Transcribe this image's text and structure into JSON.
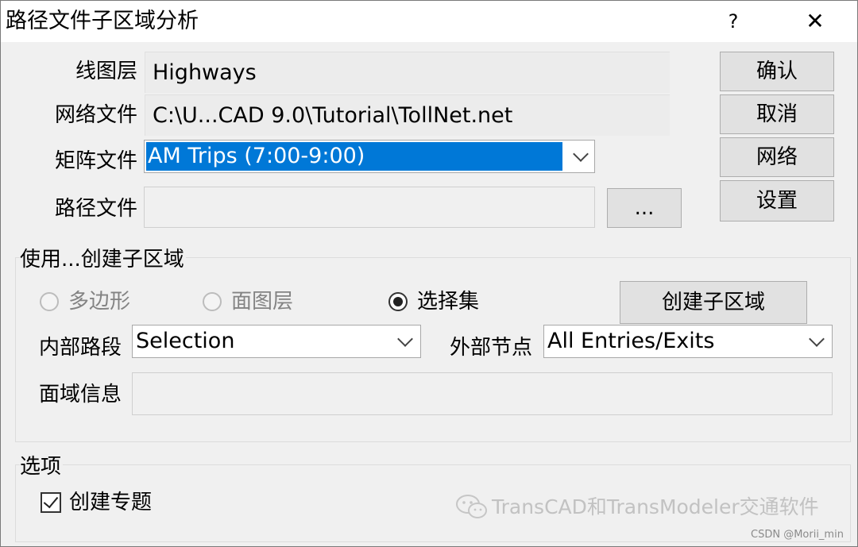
{
  "window": {
    "title": "路径文件子区域分析",
    "help_label": "?",
    "close_label": "✕"
  },
  "fields": {
    "line_layer": {
      "label": "线图层",
      "value": "Highways"
    },
    "network_file": {
      "label": "网络文件",
      "value": "C:\\U...CAD 9.0\\Tutorial\\TollNet.net"
    },
    "matrix_file": {
      "label": "矩阵文件",
      "value": "AM Trips (7:00-9:00)"
    },
    "path_file": {
      "label": "路径文件",
      "value": ""
    },
    "browse_label": "..."
  },
  "buttons": {
    "ok": "确认",
    "cancel": "取消",
    "network": "网络",
    "settings": "设置"
  },
  "subarea_group": {
    "title": "使用...创建子区域",
    "radio_polygon": "多边形",
    "radio_area_layer": "面图层",
    "radio_selection": "选择集",
    "selected_option": "选择集",
    "create_button": "创建子区域",
    "internal_links": {
      "label": "内部路段",
      "value": "Selection"
    },
    "external_nodes": {
      "label": "外部节点",
      "value": "All Entries/Exits"
    },
    "area_info": {
      "label": "面域信息",
      "value": ""
    }
  },
  "options_group": {
    "title": "选项",
    "create_theme": {
      "label": "创建专题",
      "checked": true
    }
  },
  "watermark": {
    "text": "TransCAD和TransModeler交通软件",
    "icon": "wechat-icon",
    "credit": "CSDN @Morii_min"
  }
}
